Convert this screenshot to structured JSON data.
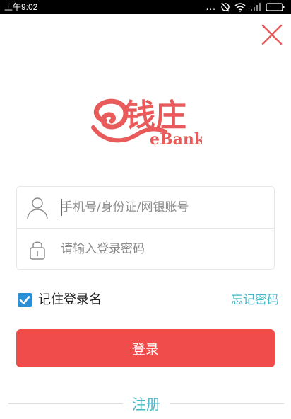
{
  "status_bar": {
    "time": "上午9:02",
    "dots": "...",
    "icons": [
      "sync-disabled-icon",
      "wifi-icon",
      "signal-icon",
      "battery-icon"
    ]
  },
  "brand": {
    "logo_text": "钱庄",
    "logo_sub": "eBank",
    "color": "#e95a5a"
  },
  "form": {
    "account_placeholder": "手机号/身份证/网银账号",
    "account_value": "",
    "password_placeholder": "请输入登录密码",
    "password_value": "",
    "remember_label": "记住登录名",
    "remember_checked": true,
    "forgot_label": "忘记密码",
    "login_label": "登录",
    "register_label": "注册"
  },
  "colors": {
    "accent": "#f04c4c",
    "link": "#48b7c7",
    "checkbox": "#2b8fd6",
    "close": "#e85a5a"
  }
}
